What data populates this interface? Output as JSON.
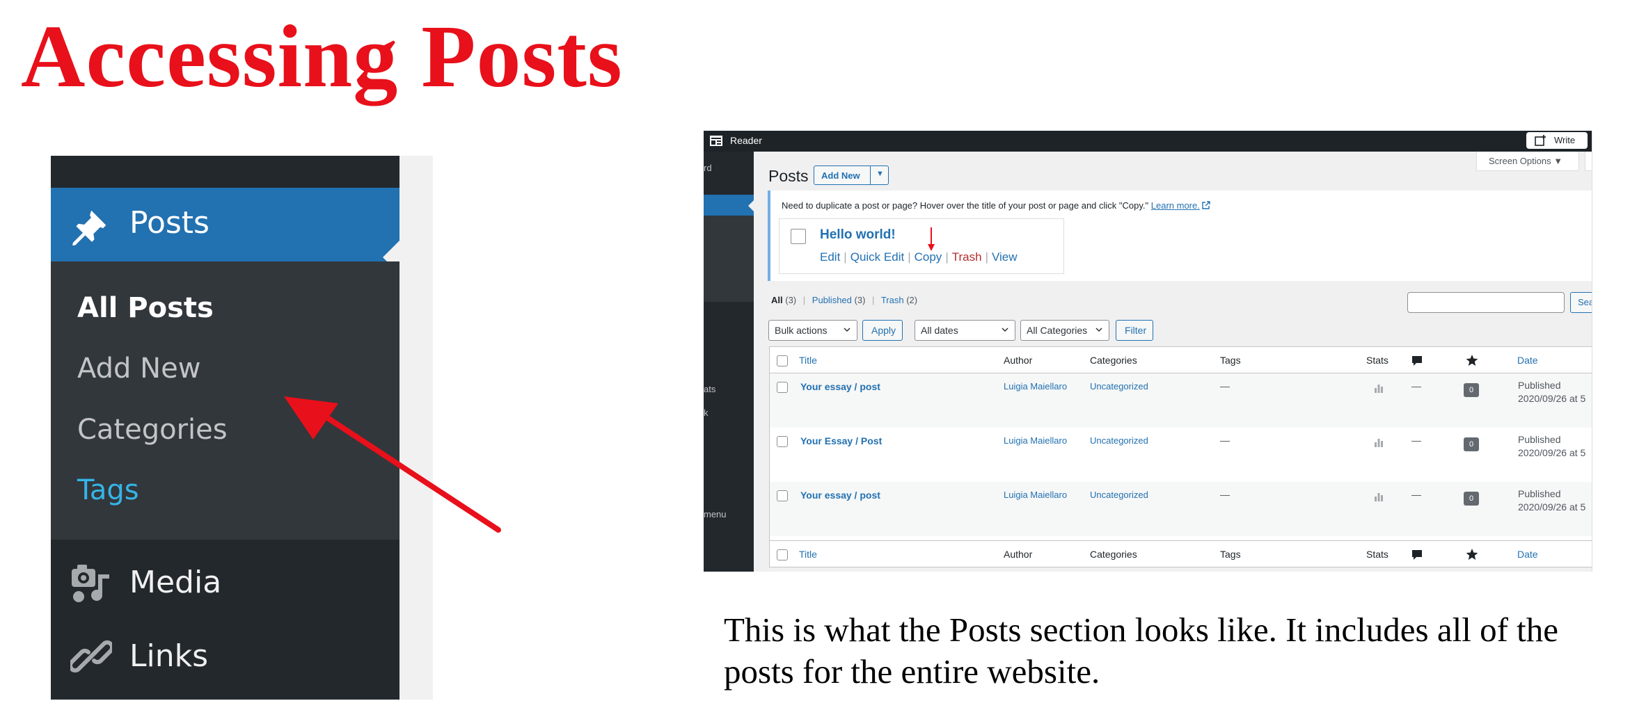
{
  "slide": {
    "title": "Accessing Posts",
    "caption": "This is what the Posts section looks like. It includes all of the posts for the entire website."
  },
  "zoom_menu": {
    "posts_label": "Posts",
    "submenu": [
      "All Posts",
      "Add New",
      "Categories",
      "Tags"
    ],
    "media_label": "Media",
    "links_label": "Links",
    "colors": {
      "active": "#2271b1",
      "menu_bg": "#23282d",
      "submenu_bg": "#32373c",
      "tags_link": "#35b5e8",
      "arrow": "#e8101a"
    }
  },
  "wp": {
    "topbar": {
      "reader": "Reader",
      "write": "Write"
    },
    "side_fragments": [
      "rd",
      "ats",
      "k",
      "menu"
    ],
    "page_title": "Posts",
    "add_new": "Add New",
    "screen_options": "Screen Options ▼",
    "notice": {
      "text": "Need to duplicate a post or page? Hover over the title of your post or page and click \"Copy.\"",
      "link": "Learn more.",
      "post_title": "Hello world!",
      "actions": {
        "edit": "Edit",
        "quick_edit": "Quick Edit",
        "copy": "Copy",
        "trash": "Trash",
        "view": "View"
      }
    },
    "views": {
      "all": "All",
      "all_count": "(3)",
      "published": "Published",
      "published_count": "(3)",
      "trash": "Trash",
      "trash_count": "(2)"
    },
    "search_button": "Sear",
    "filters": {
      "bulk": "Bulk actions",
      "apply": "Apply",
      "dates": "All dates",
      "categories": "All Categories",
      "filter": "Filter"
    },
    "columns": {
      "title": "Title",
      "author": "Author",
      "categories": "Categories",
      "tags": "Tags",
      "stats": "Stats",
      "date": "Date"
    },
    "rows": [
      {
        "title": "Your essay / post",
        "author": "Luigia Maiellaro",
        "category": "Uncategorized",
        "tags": "—",
        "comments_dash": "—",
        "likes": "0",
        "status": "Published",
        "date": "2020/09/26 at 5"
      },
      {
        "title": "Your Essay / Post",
        "author": "Luigia Maiellaro",
        "category": "Uncategorized",
        "tags": "—",
        "comments_dash": "—",
        "likes": "0",
        "status": "Published",
        "date": "2020/09/26 at 5"
      },
      {
        "title": "Your essay / post",
        "author": "Luigia Maiellaro",
        "category": "Uncategorized",
        "tags": "—",
        "comments_dash": "—",
        "likes": "0",
        "status": "Published",
        "date": "2020/09/26 at 5"
      }
    ]
  }
}
